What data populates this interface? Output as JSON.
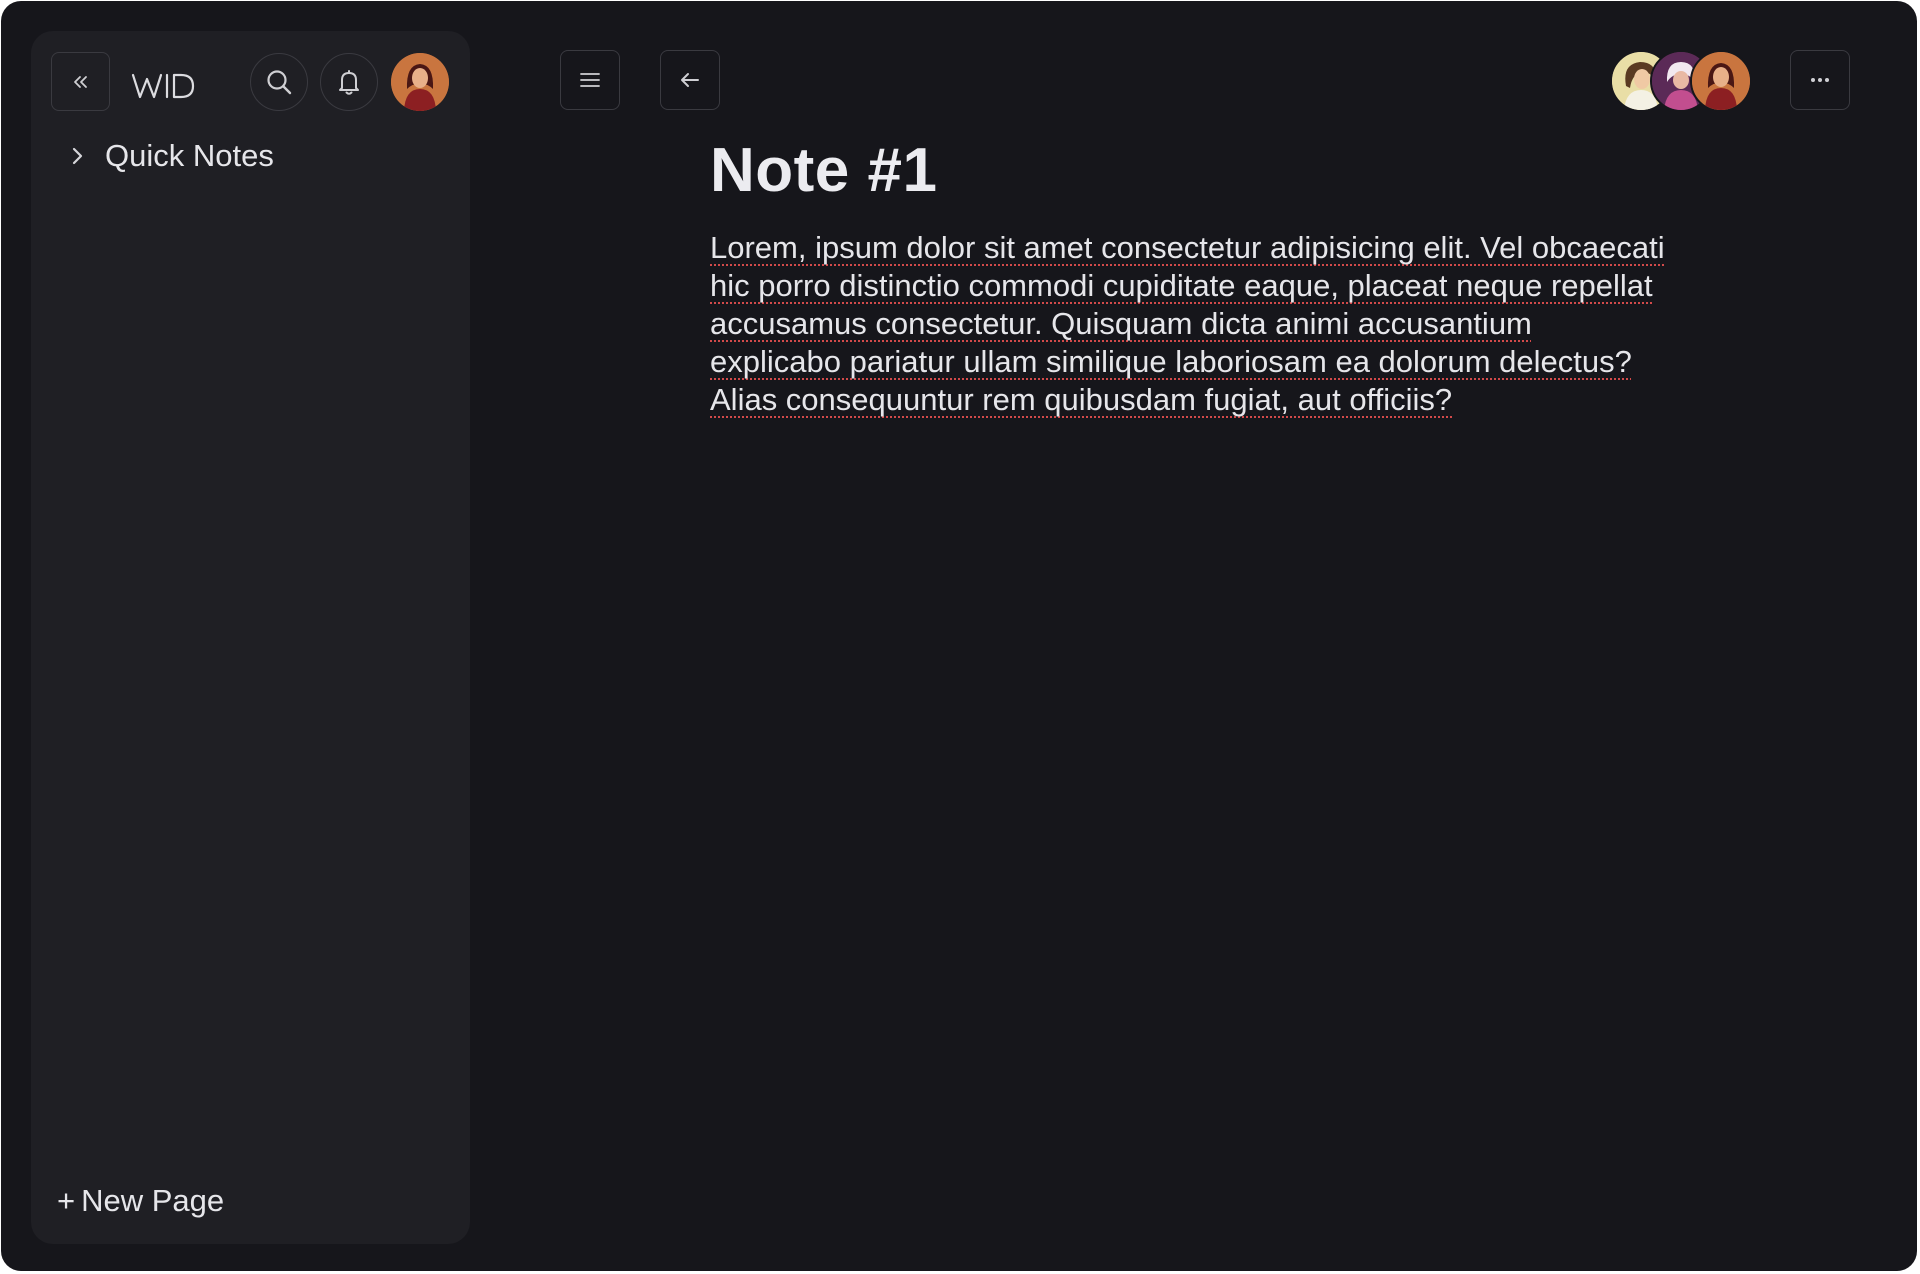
{
  "app": {
    "logo_text": "WID"
  },
  "sidebar": {
    "collapse_icon": "double-chevron-left-icon",
    "search_icon": "search-icon",
    "notifications_icon": "bell-icon",
    "tree": [
      {
        "label": "Quick Notes",
        "icon": "chevron-right-icon"
      }
    ],
    "new_page": {
      "plus": "+",
      "label": "New Page"
    }
  },
  "toolbar": {
    "menu_icon": "hamburger-menu-icon",
    "back_icon": "arrow-left-icon",
    "more_icon": "more-horizontal-icon"
  },
  "collaborators": {
    "count": 3
  },
  "document": {
    "title": "Note #1",
    "body": "Lorem, ipsum dolor sit amet consectetur adipisicing elit. Vel obcaecati hic porro distinctio commodi cupiditate eaque, placeat neque repellat accusamus consectetur. Quisquam dicta animi accusantium explicabo pariatur ullam similique laboriosam ea dolorum delectus? Alias consequuntur rem quibusdam fugiat, aut officiis?"
  },
  "colors": {
    "background": "#16161b",
    "sidebar": "#1f1f24",
    "text": "#e6e6ea",
    "spellcheck": "#d24a4a"
  }
}
